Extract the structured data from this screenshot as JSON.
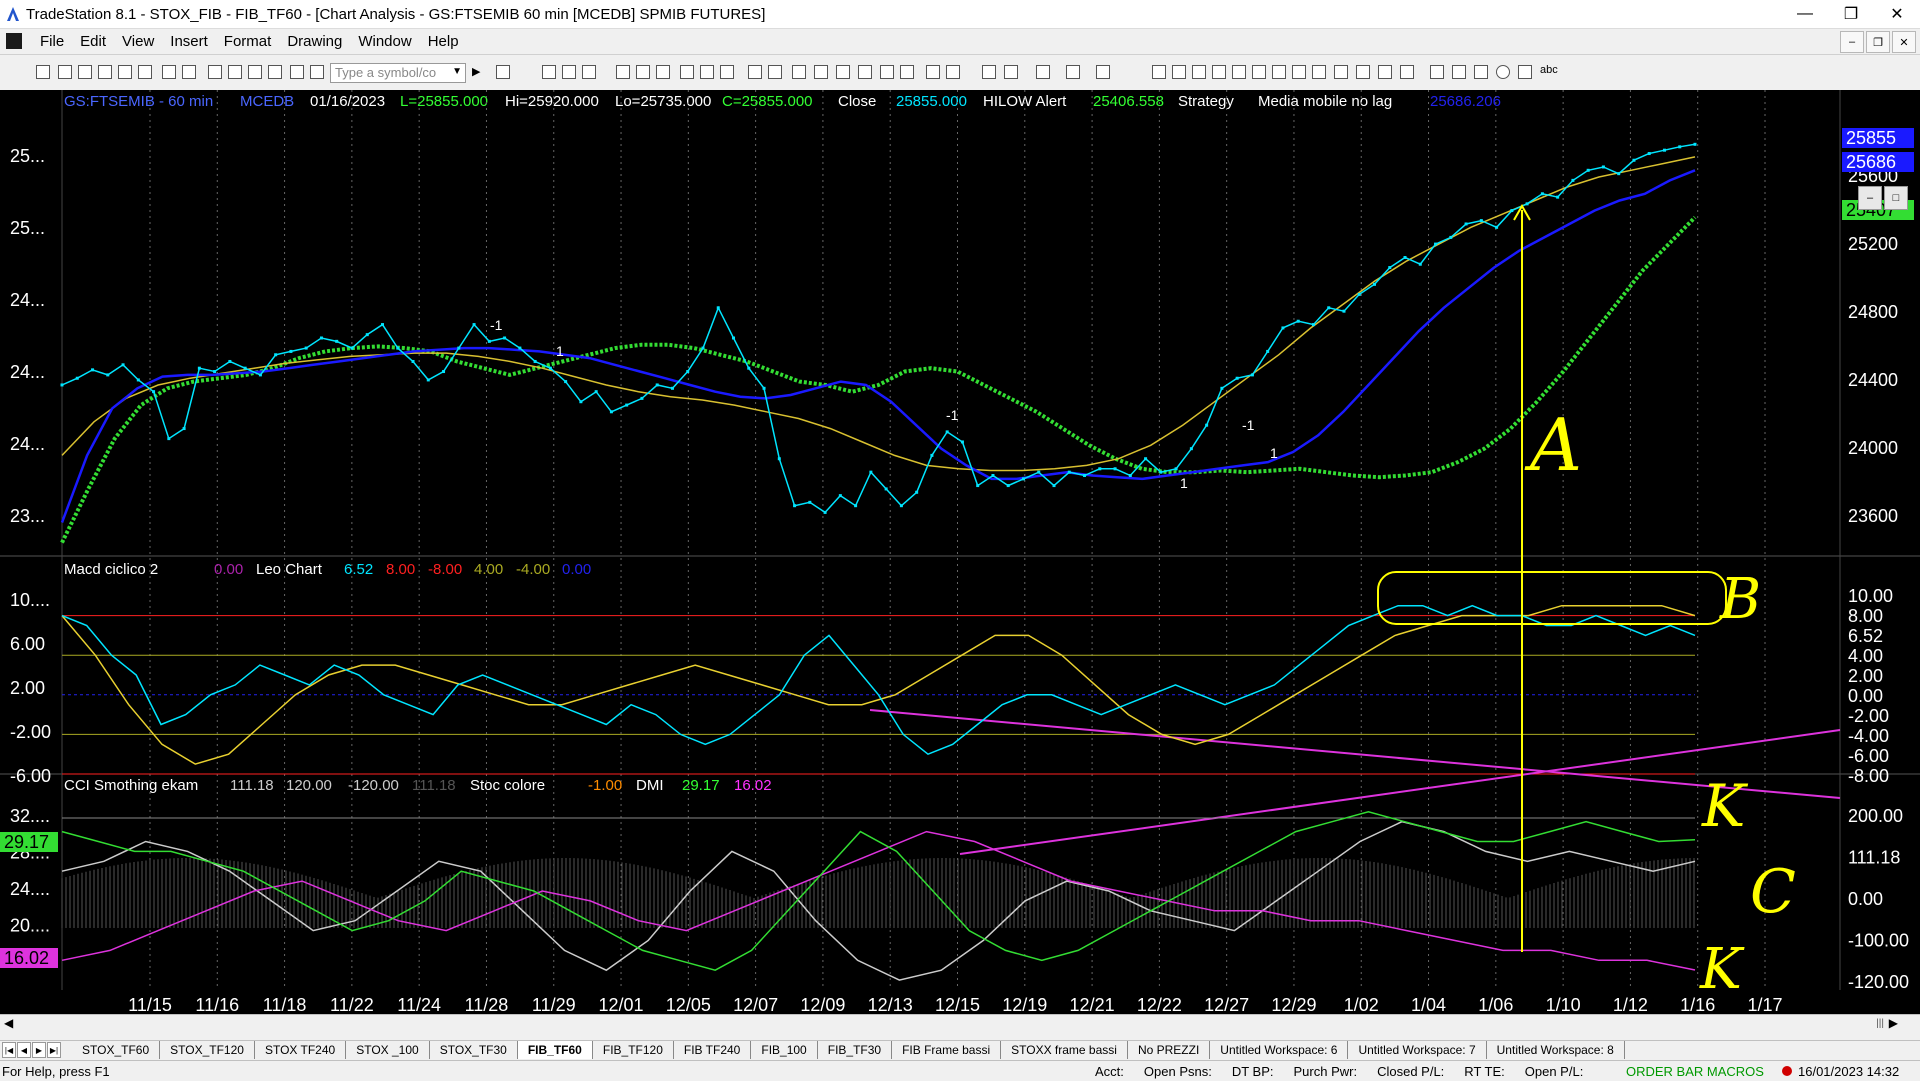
{
  "window": {
    "title": "TradeStation 8.1 - STOX_FIB - FIB_TF60 - [Chart Analysis - GS:FTSEMIB  60 min  [MCEDB] SPMIB FUTURES]",
    "minimize": "—",
    "maximize": "❐",
    "close": "✕"
  },
  "menu": [
    "File",
    "Edit",
    "View",
    "Insert",
    "Format",
    "Drawing",
    "Window",
    "Help"
  ],
  "mdi_buttons": [
    "–",
    "❐",
    "✕"
  ],
  "toolbar": {
    "symbol_placeholder": "Type a symbol/co",
    "abc_label": "abc"
  },
  "chart_data": {
    "type": "line",
    "symbol_header": {
      "symbol": "GS:FTSEMIB - 60 min",
      "feed": "MCEDB",
      "date": "01/16/2023",
      "last": "L=25855.000",
      "high": "Hi=25920.000",
      "low": "Lo=25735.000",
      "close": "C=25855.000",
      "close_label": "Close",
      "close_value": "25855.000",
      "hilow_label": "HILOW Alert",
      "hilow_value": "25406.558",
      "strategy_label": "Strategy",
      "ma_label": "Media mobile no lag",
      "ma_value": "25686.206"
    },
    "x_labels": [
      "11/15",
      "11/16",
      "11/18",
      "11/22",
      "11/24",
      "11/28",
      "11/29",
      "12/01",
      "12/05",
      "12/07",
      "12/09",
      "12/13",
      "12/15",
      "12/19",
      "12/21",
      "12/22",
      "12/27",
      "12/29",
      "1/02",
      "1/04",
      "1/06",
      "1/10",
      "1/12",
      "1/16",
      "1/17"
    ],
    "price_panel": {
      "left_ticks": [
        "25...",
        "25...",
        "24...",
        "24...",
        "24...",
        "23..."
      ],
      "right_ticks": [
        "25600",
        "25200",
        "24800",
        "24400",
        "24000",
        "23600"
      ],
      "ylim": [
        23400,
        26000
      ],
      "tags": {
        "last": "25855",
        "ma": "25686",
        "green": "25407",
        "yellow_hidden": "25600"
      },
      "signals": [
        "-1",
        "1",
        "-1",
        "1",
        "-1",
        "1",
        "-1",
        "1"
      ],
      "price_series": [
        24420,
        24460,
        24510,
        24480,
        24540,
        24450,
        24380,
        24100,
        24160,
        24520,
        24500,
        24560,
        24520,
        24480,
        24600,
        24620,
        24640,
        24700,
        24680,
        24640,
        24720,
        24780,
        24640,
        24560,
        24450,
        24500,
        24640,
        24780,
        24680,
        24700,
        24640,
        24560,
        24520,
        24440,
        24320,
        24380,
        24260,
        24300,
        24340,
        24420,
        24400,
        24500,
        24640,
        24880,
        24700,
        24520,
        24400,
        23980,
        23700,
        23720,
        23660,
        23760,
        23700,
        23900,
        23800,
        23700,
        23780,
        24000,
        24140,
        24080,
        23820,
        23880,
        23820,
        23860,
        23900,
        23820,
        23900,
        23880,
        23920,
        23920,
        23880,
        23980,
        23900,
        23920,
        24040,
        24180,
        24400,
        24460,
        24480,
        24620,
        24760,
        24800,
        24780,
        24880,
        24860,
        24960,
        25020,
        25120,
        25180,
        25140,
        25260,
        25300,
        25380,
        25400,
        25360,
        25460,
        25500,
        25560,
        25540,
        25640,
        25700,
        25720,
        25680,
        25760,
        25800,
        25820,
        25840,
        25855
      ],
      "blue_series": [
        23600,
        24000,
        24280,
        24400,
        24470,
        24480,
        24480,
        24490,
        24500,
        24520,
        24540,
        24560,
        24580,
        24600,
        24620,
        24630,
        24640,
        24640,
        24630,
        24620,
        24600,
        24580,
        24540,
        24500,
        24460,
        24420,
        24380,
        24350,
        24340,
        24360,
        24400,
        24440,
        24420,
        24320,
        24180,
        24040,
        23940,
        23860,
        23860,
        23880,
        23900,
        23880,
        23870,
        23860,
        23880,
        23900,
        23920,
        23940,
        23960,
        24020,
        24120,
        24260,
        24420,
        24580,
        24740,
        24880,
        25000,
        25120,
        25220,
        25300,
        25380,
        25460,
        25520,
        25560,
        25640,
        25700
      ],
      "yellow_series": [
        24000,
        24200,
        24340,
        24420,
        24460,
        24490,
        24520,
        24550,
        24570,
        24590,
        24600,
        24610,
        24610,
        24590,
        24560,
        24520,
        24470,
        24420,
        24380,
        24350,
        24330,
        24300,
        24260,
        24220,
        24160,
        24080,
        24000,
        23940,
        23920,
        23910,
        23910,
        23920,
        23940,
        23980,
        24060,
        24180,
        24320,
        24460,
        24600,
        24760,
        24900,
        25040,
        25160,
        25260,
        25360,
        25440,
        25520,
        25600,
        25660,
        25700,
        25740,
        25780
      ],
      "red_green_series": [
        23480,
        23800,
        24100,
        24300,
        24400,
        24440,
        24460,
        24480,
        24520,
        24580,
        24620,
        24640,
        24650,
        24640,
        24620,
        24560,
        24520,
        24480,
        24520,
        24560,
        24600,
        24640,
        24660,
        24660,
        24640,
        24600,
        24560,
        24500,
        24440,
        24420,
        24380,
        24420,
        24500,
        24520,
        24500,
        24420,
        24340,
        24260,
        24160,
        24060,
        23980,
        23920,
        23900,
        23900,
        23910,
        23900,
        23910,
        23920,
        23900,
        23880,
        23870,
        23880,
        23900,
        23960,
        24040,
        24160,
        24320,
        24500,
        24700,
        24900,
        25100,
        25260,
        25420
      ]
    },
    "macd_panel": {
      "label": "Macd ciclico 2",
      "v1": "0.00",
      "leo_label": "Leo Chart",
      "v2": "6.52",
      "v3": "8.00",
      "v4": "-8.00",
      "v5": "4.00",
      "v6": "-4.00",
      "v7": "0.00",
      "left_ticks": [
        "10....",
        "6.00",
        "2.00",
        "-2.00",
        "-6.00"
      ],
      "right_ticks": [
        "10.00",
        "8.00",
        "6.52",
        "4.00",
        "2.00",
        "0.00",
        "-2.00",
        "-4.00",
        "-6.00",
        "-8.00"
      ],
      "ylim": [
        -8,
        12
      ],
      "series": [
        8,
        7,
        4,
        2,
        -3,
        -2,
        0,
        1,
        3,
        2,
        1,
        3,
        2,
        0,
        -1,
        -2,
        1,
        2,
        1,
        0,
        -1,
        -2,
        -3,
        -1,
        -2,
        -4,
        -5,
        -4,
        -2,
        0,
        4,
        6,
        3,
        0,
        -4,
        -6,
        -5,
        -3,
        -1,
        0,
        0,
        -1,
        -2,
        -1,
        0,
        1,
        0,
        -1,
        0,
        1,
        3,
        5,
        7,
        8,
        9,
        9,
        8,
        9,
        8,
        8,
        7,
        7,
        8,
        7,
        6,
        7,
        6
      ],
      "yellow_series": [
        8,
        4,
        -1,
        -5,
        -7,
        -6,
        -3,
        0,
        2,
        3,
        3,
        2,
        1,
        0,
        -1,
        -1,
        0,
        1,
        2,
        3,
        2,
        1,
        0,
        -1,
        -1,
        0,
        2,
        4,
        6,
        6,
        4,
        1,
        -2,
        -4,
        -5,
        -4,
        -2,
        0,
        2,
        4,
        6,
        7,
        8,
        8,
        8,
        9,
        9,
        9,
        9,
        8
      ]
    },
    "cci_panel": {
      "label": "CCI Smothing ekam",
      "v1": "111.18",
      "v2": "120.00",
      "v3": "-120.00",
      "v4": "111.18",
      "stoc_label": "Stoc colore",
      "v5": "-1.00",
      "dmi_label": "DMI",
      "v6": "29.17",
      "v7": "16.02",
      "left_ticks": [
        "32....",
        "28....",
        "24....",
        "20....",
        "16...."
      ],
      "right_ticks": [
        "200.00",
        "111.18",
        "0.00",
        "-100.00",
        "-120.00"
      ],
      "tag_left_green": "29.17",
      "tag_left_magenta": "16.02",
      "green_series": [
        30,
        29,
        28,
        28,
        27,
        26,
        24,
        22,
        20,
        21,
        23,
        26,
        25,
        24,
        22,
        20,
        18,
        17,
        16,
        18,
        22,
        26,
        30,
        28,
        24,
        20,
        18,
        17,
        18,
        20,
        22,
        24,
        26,
        28,
        30,
        31,
        32,
        31,
        30,
        29,
        29,
        30,
        31,
        30,
        29,
        29.17
      ],
      "magenta_series": [
        17,
        18,
        20,
        22,
        24,
        25,
        23,
        21,
        20,
        22,
        24,
        23,
        21,
        20,
        22,
        24,
        26,
        28,
        30,
        29,
        27,
        25,
        24,
        23,
        22,
        22,
        21,
        21,
        20,
        19,
        18,
        18,
        17,
        17,
        16.02
      ],
      "white_series": [
        26,
        27,
        29,
        28,
        26,
        23,
        20,
        21,
        24,
        27,
        26,
        22,
        18,
        16,
        19,
        24,
        28,
        26,
        21,
        17,
        15,
        16,
        19,
        23,
        25,
        24,
        22,
        21,
        20,
        23,
        26,
        29,
        31,
        30,
        28,
        27,
        28,
        27,
        26,
        27
      ]
    }
  },
  "annotations": [
    "A",
    "B",
    "K",
    "C",
    "K"
  ],
  "workspace_tabs": [
    "STOX_TF60",
    "STOX_TF120",
    "STOX TF240",
    "STOX _100",
    "STOX_TF30",
    "FIB_TF60",
    "FIB_TF120",
    "FIB TF240",
    "FIB_100",
    "FIB_TF30",
    "FIB Frame bassi",
    "STOXX frame bassi",
    "No PREZZI",
    "Untitled Workspace:  6",
    "Untitled Workspace:  7",
    "Untitled Workspace:  8"
  ],
  "active_tab": "FIB_TF60",
  "status": {
    "help": "For Help, press F1",
    "acct": "Acct:",
    "open_psns": "Open Psns:",
    "dt_bp": "DT BP:",
    "purch_pwr": "Purch Pwr:",
    "closed_pl": "Closed P/L:",
    "rt_te": "RT TE:",
    "open_pl": "Open P/L:",
    "order_bar": "ORDER BAR  MACROS",
    "clock": "16/01/2023 14:32"
  },
  "colors": {
    "cyan": "#00e5ff",
    "blue": "#1a1aff",
    "yellow": "#ffff66",
    "red": "#ff2020",
    "green": "#33dd33",
    "magenta": "#dd33dd",
    "orange": "#ff8c00"
  }
}
